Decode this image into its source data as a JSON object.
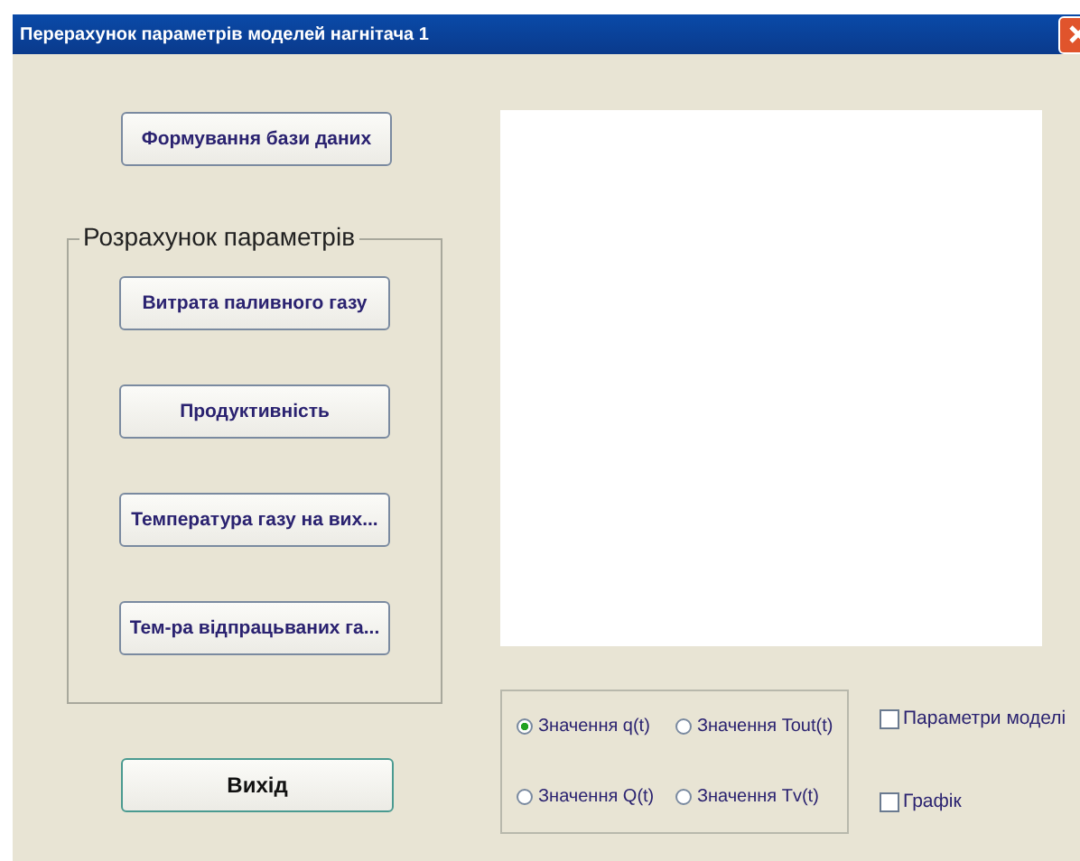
{
  "window": {
    "title": "Перерахунок параметрів моделей  нагнітача 1"
  },
  "top_button": "Формування бази даних",
  "group": {
    "title": "Розрахунок параметрів",
    "buttons": [
      "Витрата паливного газу",
      "Продуктивність",
      "Температура газу на вих...",
      "Тем-ра відпрацьваних га..."
    ]
  },
  "exit_button": "Вихід",
  "radios": [
    {
      "label": "Значення q(t)",
      "selected": true
    },
    {
      "label": "Значення Tout(t)",
      "selected": false
    },
    {
      "label": "Значення Q(t)",
      "selected": false
    },
    {
      "label": "Значення Tv(t)",
      "selected": false
    }
  ],
  "checkboxes": [
    {
      "label": "Параметри моделі",
      "checked": false
    },
    {
      "label": "Графік",
      "checked": false
    }
  ]
}
